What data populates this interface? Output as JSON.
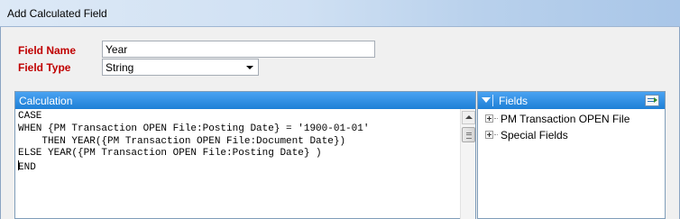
{
  "window": {
    "title": "Add Calculated Field"
  },
  "form": {
    "field_name_label": "Field Name",
    "field_name_value": "Year",
    "field_type_label": "Field Type",
    "field_type_value": "String"
  },
  "calculation": {
    "header": "Calculation",
    "lines": [
      "CASE",
      "WHEN {PM Transaction OPEN File:Posting Date} = '1900-01-01'",
      "    THEN YEAR({PM Transaction OPEN File:Document Date})",
      "ELSE YEAR({PM Transaction OPEN File:Posting Date} )",
      "END"
    ]
  },
  "fields": {
    "header": "Fields",
    "items": [
      "PM Transaction OPEN File",
      "Special Fields"
    ]
  },
  "icons": {
    "collapse": "chevron-down-icon",
    "insert": "insert-field-icon",
    "expand": "plus-box-icon"
  },
  "colors": {
    "label_red": "#c00000",
    "header_blue": "#1e7fd6"
  }
}
